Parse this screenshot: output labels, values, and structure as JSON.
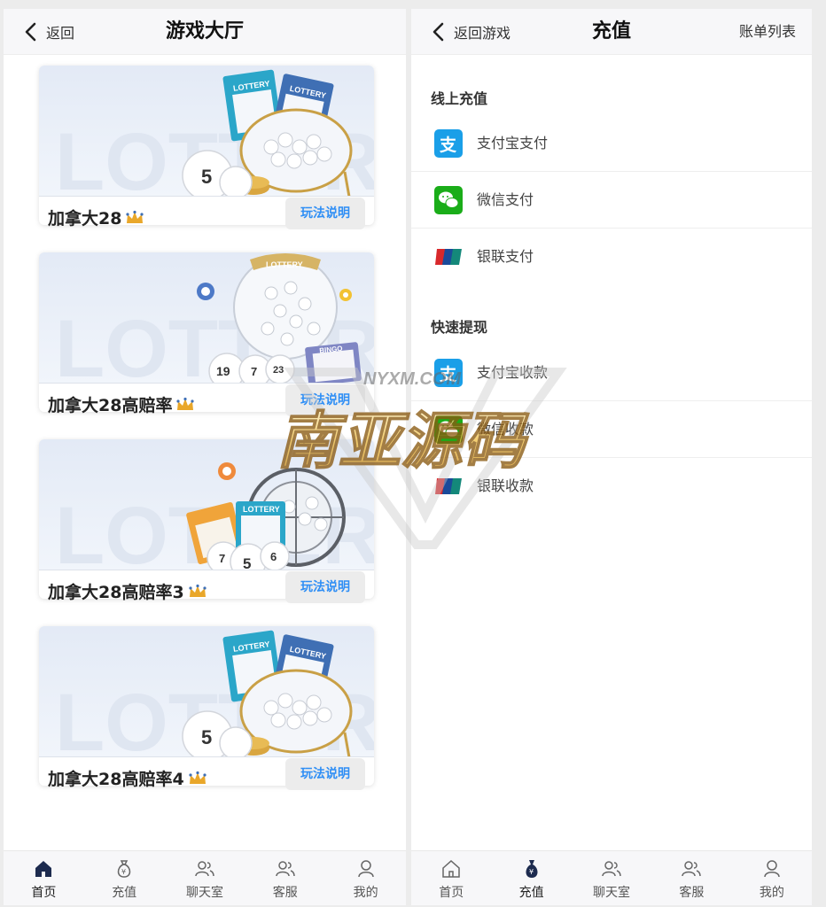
{
  "lobby": {
    "back_label": "返回",
    "title": "游戏大厅",
    "cards": [
      {
        "name": "加拿大28",
        "button": "玩法说明"
      },
      {
        "name": "加拿大28高赔率",
        "button": "玩法说明"
      },
      {
        "name": "加拿大28高赔率3",
        "button": "玩法说明"
      },
      {
        "name": "加拿大28高赔率4",
        "button": "玩法说明"
      }
    ],
    "banner_text": {
      "lottery": "LOTTERY",
      "bingo": "BINGO",
      "ball_5": "5",
      "ball_7": "7",
      "ball_19": "19",
      "ball_23": "23",
      "ball_6": "6"
    }
  },
  "recharge": {
    "back_label": "返回游戏",
    "title": "充值",
    "bills_label": "账单列表",
    "online_section": "线上充值",
    "online_methods": [
      {
        "label": "支付宝支付",
        "icon": "alipay-icon"
      },
      {
        "label": "微信支付",
        "icon": "wechat-icon"
      },
      {
        "label": "银联支付",
        "icon": "unionpay-icon"
      }
    ],
    "withdraw_section": "快速提现",
    "withdraw_methods": [
      {
        "label": "支付宝收款",
        "icon": "alipay-icon"
      },
      {
        "label": "微信收款",
        "icon": "wechat-icon"
      },
      {
        "label": "银联收款",
        "icon": "unionpay-icon"
      }
    ]
  },
  "tabbar": {
    "tabs": [
      {
        "label": "首页",
        "icon": "home-icon"
      },
      {
        "label": "充值",
        "icon": "money-bag-icon"
      },
      {
        "label": "聊天室",
        "icon": "chat-users-icon"
      },
      {
        "label": "客服",
        "icon": "support-icon"
      },
      {
        "label": "我的",
        "icon": "profile-icon"
      }
    ],
    "left_active": 0,
    "right_active": 1
  },
  "watermark": {
    "url_text": "NYXM.COM",
    "text": "南亚源码"
  },
  "colors": {
    "link_blue": "#2e8ef5",
    "crown_gold": "#e9a72a",
    "alipay": "#1a9fe8",
    "wechat": "#1aad19",
    "unionpay_red": "#d8282b"
  }
}
